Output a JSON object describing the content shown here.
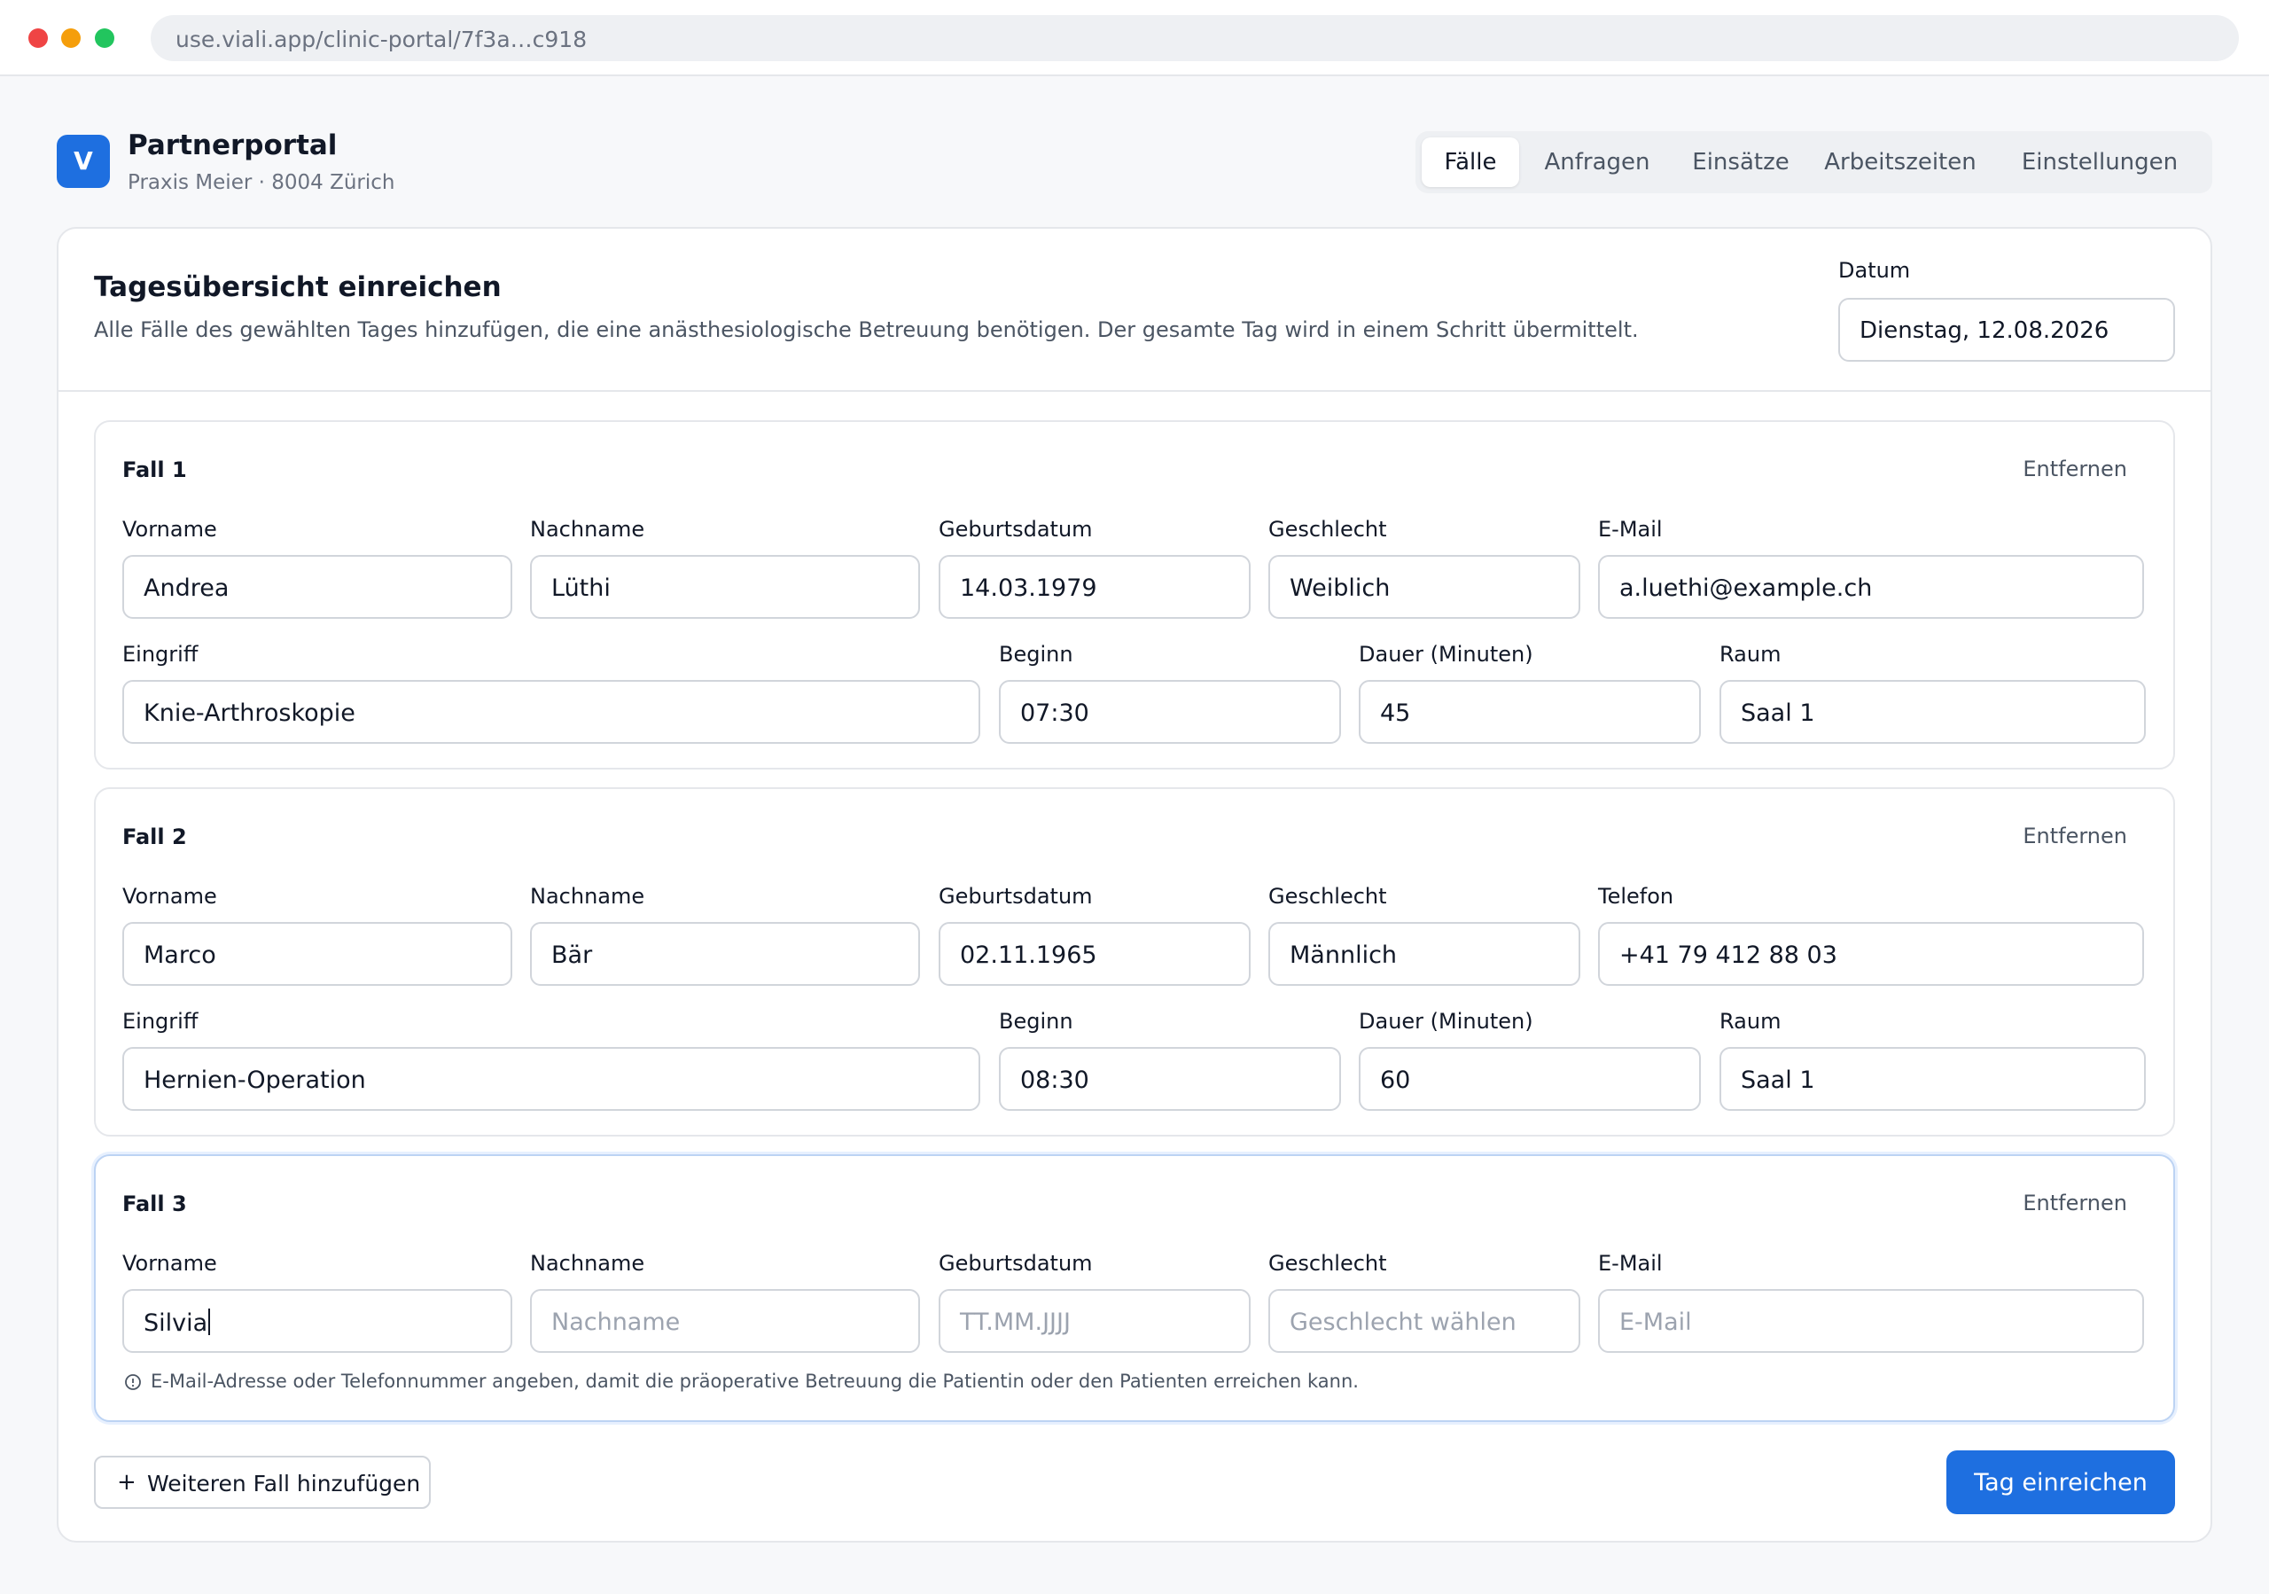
{
  "browser": {
    "url": "use.viali.app/clinic-portal/7f3a…c918"
  },
  "header": {
    "logo_letter": "V",
    "title": "Partnerportal",
    "subtitle": "Praxis Meier · 8004 Zürich",
    "tabs": [
      "Fälle",
      "Anfragen",
      "Einsätze",
      "Arbeitszeiten",
      "Einstellungen"
    ],
    "active_tab": "Fälle"
  },
  "form": {
    "title": "Tagesübersicht einreichen",
    "description": "Alle Fälle des gewählten Tages hinzufügen, die eine anästhesiologische Betreuung benötigen. Der gesamte Tag wird in einem Schritt übermittelt.",
    "date_label": "Datum",
    "date_value": "Dienstag, 12.08.2026",
    "remove_label": "Entfernen",
    "cases": [
      {
        "title": "Fall 1",
        "labels": {
          "firstname": "Vorname",
          "lastname": "Nachname",
          "birthdate": "Geburtsdatum",
          "gender": "Geschlecht",
          "contact": "E-Mail",
          "procedure": "Eingriff",
          "start": "Beginn",
          "duration": "Dauer (Minuten)",
          "room": "Raum"
        },
        "values": {
          "firstname": "Andrea",
          "lastname": "Lüthi",
          "birthdate": "14.03.1979",
          "gender": "Weiblich",
          "contact": "a.luethi@example.ch",
          "procedure": "Knie-Arthroskopie",
          "start": "07:30",
          "duration": "45",
          "room": "Saal 1"
        }
      },
      {
        "title": "Fall 2",
        "labels": {
          "firstname": "Vorname",
          "lastname": "Nachname",
          "birthdate": "Geburtsdatum",
          "gender": "Geschlecht",
          "contact": "Telefon",
          "procedure": "Eingriff",
          "start": "Beginn",
          "duration": "Dauer (Minuten)",
          "room": "Raum"
        },
        "values": {
          "firstname": "Marco",
          "lastname": "Bär",
          "birthdate": "02.11.1965",
          "gender": "Männlich",
          "contact": "+41 79 412 88 03",
          "procedure": "Hernien-Operation",
          "start": "08:30",
          "duration": "60",
          "room": "Saal 1"
        }
      },
      {
        "title": "Fall 3",
        "labels": {
          "firstname": "Vorname",
          "lastname": "Nachname",
          "birthdate": "Geburtsdatum",
          "gender": "Geschlecht",
          "contact": "E-Mail"
        },
        "values": {
          "firstname": "Silvia"
        },
        "placeholders": {
          "lastname": "Nachname",
          "birthdate": "TT.MM.JJJJ",
          "gender": "Geschlecht wählen",
          "contact": "E-Mail"
        },
        "hint": "E-Mail-Adresse oder Telefonnummer angeben, damit die präoperative Betreuung die Patientin oder den Patienten erreichen kann."
      }
    ],
    "add_case_label": "Weiteren Fall hinzufügen",
    "submit_label": "Tag einreichen"
  },
  "colors": {
    "accent": "#1e6fe0",
    "border": "#d1d5db",
    "focus_border": "#bcd3f3"
  }
}
